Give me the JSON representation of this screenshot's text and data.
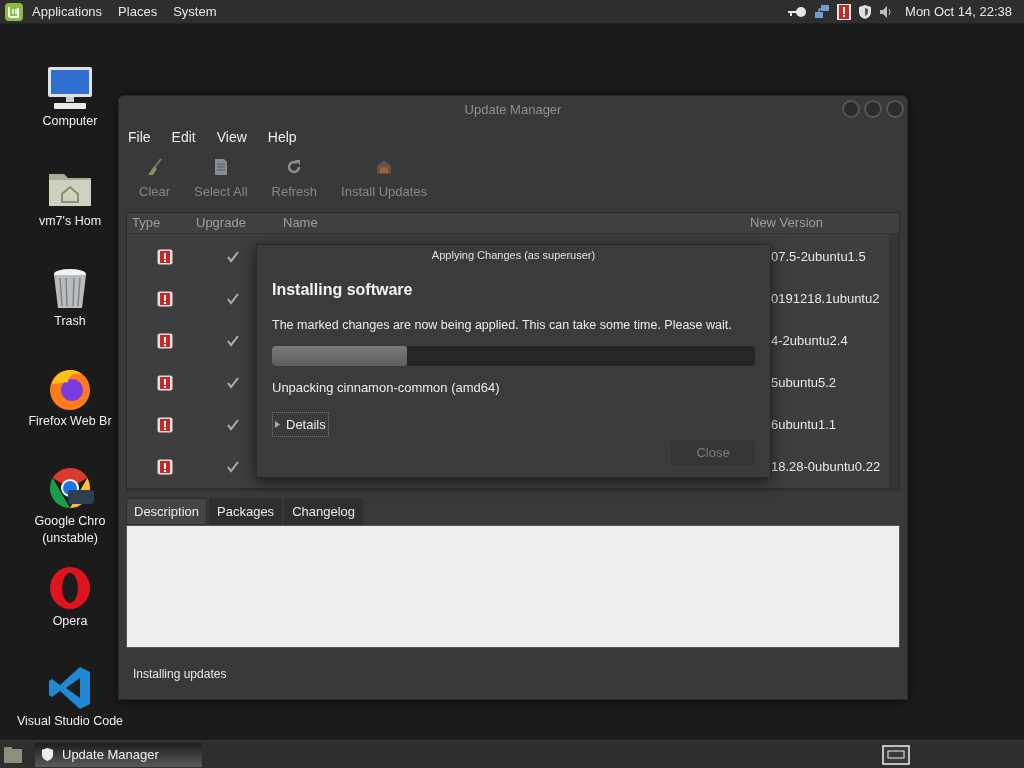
{
  "top_panel": {
    "menus": [
      "Applications",
      "Places",
      "System"
    ],
    "clock": "Mon Oct 14, 22:38"
  },
  "desktop_icons": [
    {
      "kind": "computer",
      "label": [
        "Computer"
      ]
    },
    {
      "kind": "home",
      "label": [
        "vm7's Hom"
      ]
    },
    {
      "kind": "trash",
      "label": [
        "Trash"
      ]
    },
    {
      "kind": "firefox",
      "label": [
        "Firefox Web Br"
      ]
    },
    {
      "kind": "chrome",
      "label": [
        "Google Chro",
        "(unstable)"
      ]
    },
    {
      "kind": "opera",
      "label": [
        "Opera"
      ]
    },
    {
      "kind": "vscode",
      "label": [
        "Visual Studio Code"
      ]
    }
  ],
  "window": {
    "title": "Update Manager",
    "menu": [
      "File",
      "Edit",
      "View",
      "Help"
    ],
    "toolbar": [
      {
        "kind": "clear",
        "label": "Clear",
        "disabled": true
      },
      {
        "kind": "select_all",
        "label": "Select All",
        "disabled": true
      },
      {
        "kind": "refresh",
        "label": "Refresh",
        "disabled": true
      },
      {
        "kind": "install",
        "label": "Install Updates",
        "disabled": true
      }
    ],
    "table": {
      "columns": [
        "Type",
        "Upgrade",
        "Name",
        "New Version"
      ],
      "rows": [
        {
          "kind": "security",
          "checked": true,
          "new_version": "07.5-2ubuntu1.5"
        },
        {
          "kind": "security",
          "checked": true,
          "new_version": "0191218.1ubuntu2"
        },
        {
          "kind": "security",
          "checked": true,
          "new_version": "4-2ubuntu2.4"
        },
        {
          "kind": "security",
          "checked": true,
          "new_version": "5ubuntu5.2"
        },
        {
          "kind": "security",
          "checked": true,
          "new_version": "6ubuntu1.1"
        },
        {
          "kind": "security",
          "checked": true,
          "new_version": "18.28-0ubuntu0.22"
        }
      ]
    },
    "tabs": [
      {
        "label": "Description",
        "selected": true
      },
      {
        "label": "Packages",
        "selected": false
      },
      {
        "label": "Changelog",
        "selected": false
      }
    ],
    "status": "Installing updates"
  },
  "dialog": {
    "title": "Applying Changes (as superuser)",
    "heading": "Installing software",
    "message": "The marked changes are now being applied. This can take some time. Please wait.",
    "progress": {
      "level": 0.28
    },
    "current_action": "Unpacking cinnamon-common (amd64)",
    "details": {
      "label": "Details",
      "expanded": false
    },
    "close_button": {
      "label": "Close",
      "disabled": true
    }
  },
  "taskbar": {
    "tasks": [
      {
        "label": "Update Manager",
        "selected": true
      }
    ]
  }
}
